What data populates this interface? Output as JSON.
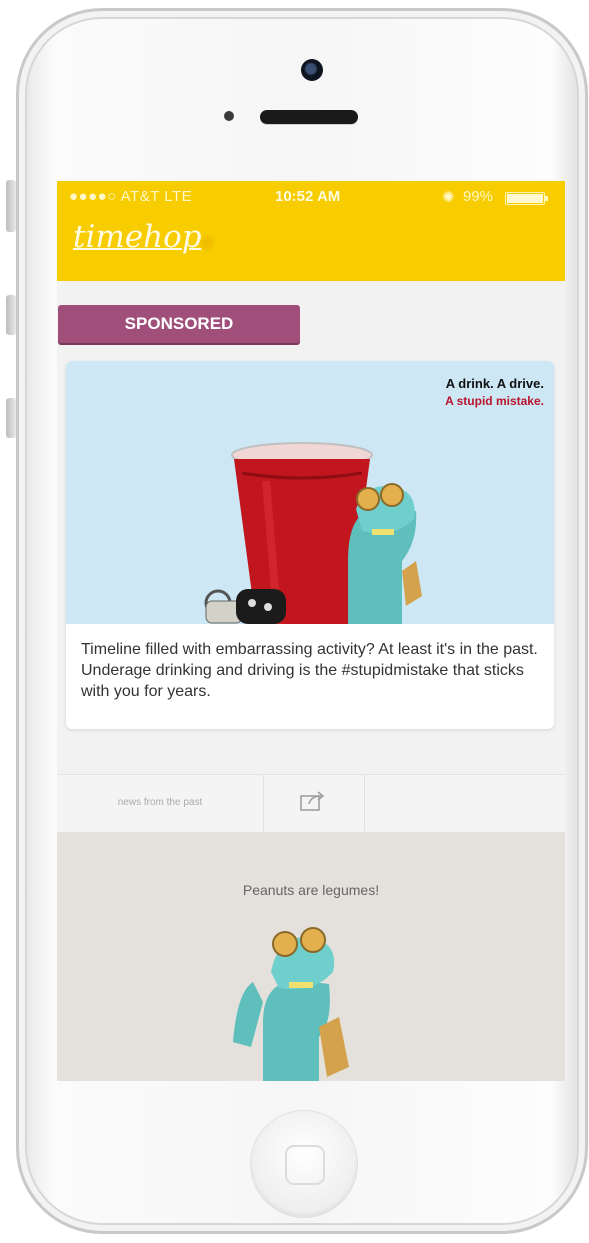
{
  "status_bar": {
    "carrier": "●●●●○ AT&T  LTE",
    "time": "10:52 AM",
    "battery_pct": "99%",
    "battery_level": 0.99
  },
  "header": {
    "logo": "timehop",
    "accent": "#f7cd00"
  },
  "sponsored": {
    "badge_label": "SPONSORED",
    "badge_color": "#a04e7a"
  },
  "ad": {
    "tagline_1": "A drink. A drive.",
    "tagline_2": "A stupid mistake.",
    "tagline_2_color": "#b8142b",
    "body": "Timeline filled with embarrassing activity? At least it's in the past. Underage drinking and driving is the #stupidmistake that sticks with you for years."
  },
  "actions": {
    "news_label": "news from the past",
    "share_icon": "share-icon"
  },
  "fact": {
    "text": "Peanuts are legumes!"
  }
}
